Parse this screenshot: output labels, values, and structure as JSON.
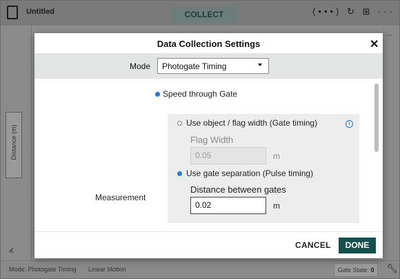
{
  "app": {
    "title": "Untitled",
    "collect_label": "COLLECT",
    "top_icons": "(•••) ↻ ⊞ ···",
    "y_axis_label": "Distance (m)",
    "right_dots": "···",
    "status_mode": "Mode: Photogate Timing",
    "status_motion": "Linear Motion",
    "gate_state_label": "Gate State:",
    "gate_state_value": "0"
  },
  "dialog": {
    "title": "Data Collection Settings",
    "close_glyph": "✕",
    "mode_label": "Mode",
    "mode_value": "Photogate Timing",
    "speed_option": "Speed through Gate",
    "object_width_option": "Use object / flag width (Gate timing)",
    "flag_width_label": "Flag Width",
    "flag_width_value": "0.05",
    "flag_width_unit": "m",
    "gate_separation_option": "Use gate separation (Pulse timing)",
    "distance_label": "Distance between gates",
    "distance_value": "0.02",
    "distance_unit": "m",
    "measurement_label": "Measurement",
    "info_glyph": "i",
    "cancel_label": "CANCEL",
    "done_label": "DONE"
  },
  "colors": {
    "accent_blue": "#1f78ca",
    "done_button": "#16504d",
    "mode_bar": "#e2e5e4"
  },
  "icons": [
    "file-icon",
    "wireless-icon",
    "undo-icon",
    "layout-icon",
    "more-icon",
    "close-icon",
    "info-icon",
    "graph-icon",
    "wrench-icon",
    "chevron-down-icon"
  ]
}
